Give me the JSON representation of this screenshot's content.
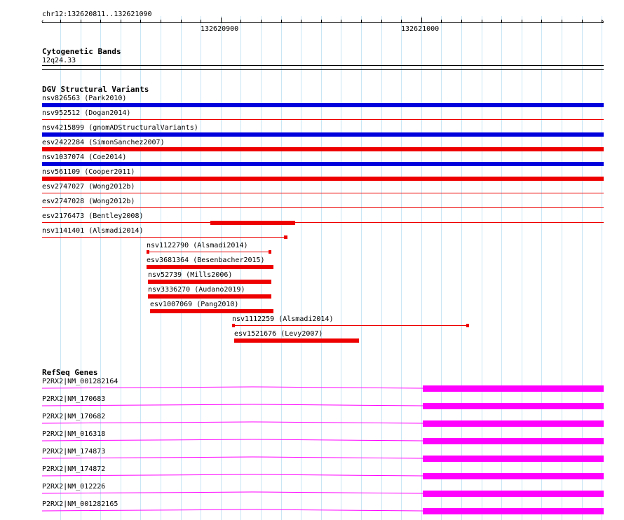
{
  "ruler": {
    "range_label": "chr12:132620811..132621090",
    "tick_labels": [
      "132620900",
      "132621000"
    ]
  },
  "cytoband": {
    "title": "Cytogenetic Bands",
    "band_label": "12q24.33"
  },
  "dgv": {
    "title": "DGV Structural Variants",
    "colors": {
      "gain": "#0000dd",
      "loss": "#ee0000"
    },
    "variants": [
      {
        "label": "nsv826563 (Park2010)"
      },
      {
        "label": "nsv952512 (Dogan2014)"
      },
      {
        "label": "nsv4215899 (gnomADStructuralVariants)"
      },
      {
        "label": "esv2422284 (SimonSanchez2007)"
      },
      {
        "label": "nsv1037074 (Coe2014)"
      },
      {
        "label": "nsv561109 (Cooper2011)"
      },
      {
        "label": "esv2747027 (Wong2012b)"
      },
      {
        "label": "esv2747028 (Wong2012b)"
      },
      {
        "label": "esv2176473 (Bentley2008)"
      },
      {
        "label": "nsv1141401 (Alsmadi2014)"
      },
      {
        "label": "nsv1122790 (Alsmadi2014)"
      },
      {
        "label": "esv3681364 (Besenbacher2015)"
      },
      {
        "label": "nsv52739 (Mills2006)"
      },
      {
        "label": "nsv3336270 (Audano2019)"
      },
      {
        "label": "esv1007069 (Pang2010)"
      },
      {
        "label": "nsv1112259 (Alsmadi2014)"
      },
      {
        "label": "esv1521676 (Levy2007)"
      }
    ]
  },
  "refseq": {
    "title": "RefSeq Genes",
    "color": "#ff00ff",
    "genes": [
      {
        "label": "P2RX2|NM_001282164"
      },
      {
        "label": "P2RX2|NM_170683"
      },
      {
        "label": "P2RX2|NM_170682"
      },
      {
        "label": "P2RX2|NM_016318"
      },
      {
        "label": "P2RX2|NM_174873"
      },
      {
        "label": "P2RX2|NM_174872"
      },
      {
        "label": "P2RX2|NM_012226"
      },
      {
        "label": "P2RX2|NM_001282165"
      }
    ]
  }
}
